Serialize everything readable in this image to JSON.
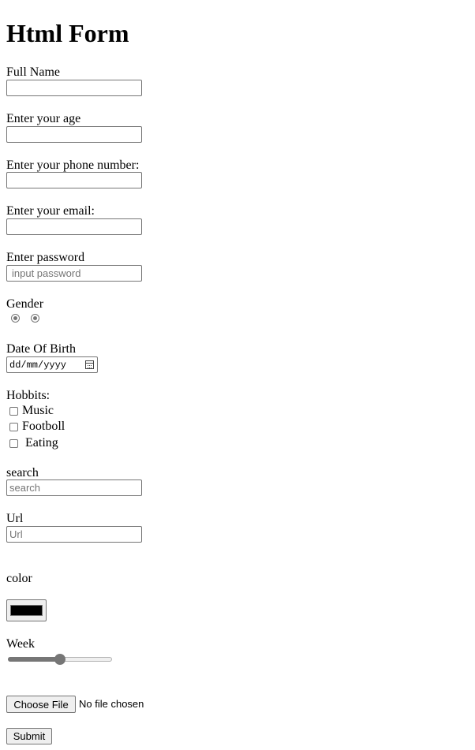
{
  "title": "Html Form",
  "fields": {
    "full_name": {
      "label": "Full Name",
      "value": ""
    },
    "age": {
      "label": "Enter your age",
      "value": ""
    },
    "phone": {
      "label": "Enter your phone number:",
      "value": ""
    },
    "email": {
      "label": "Enter your email:",
      "value": ""
    },
    "password": {
      "label": "Enter password",
      "placeholder": "input password",
      "value": ""
    }
  },
  "gender": {
    "label": "Gender",
    "options": [
      "",
      ""
    ]
  },
  "dob": {
    "label": "Date Of Birth",
    "placeholder": "dd/mm/yyyy",
    "icon": "calendar-icon"
  },
  "hobbies": {
    "label": "Hobbits:",
    "items": [
      {
        "label": "Music",
        "checked": false
      },
      {
        "label": "Footboll",
        "checked": false
      },
      {
        "label": " Eating",
        "checked": false
      }
    ]
  },
  "search": {
    "label": "search",
    "placeholder": "search"
  },
  "url": {
    "label": "Url",
    "placeholder": "Url"
  },
  "color": {
    "label": "color",
    "value": "#000000"
  },
  "week": {
    "label": "Week",
    "range_fraction": 0.5
  },
  "file": {
    "button_label": "Choose File",
    "status": "No file chosen"
  },
  "submit": {
    "label": "Submit"
  }
}
